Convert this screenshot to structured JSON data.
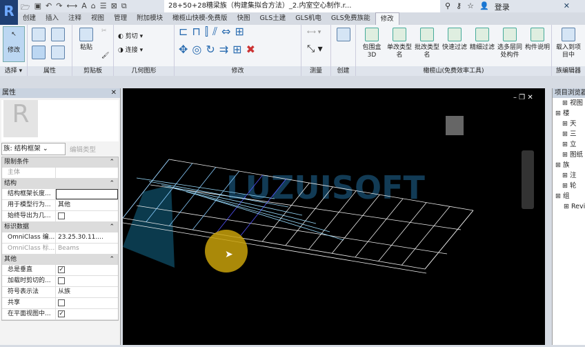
{
  "app": {
    "logo": "R",
    "doc_title": "28+50+28糟梁族（构建集拟合方法）_2.内室空心制作.r...",
    "login": "登录"
  },
  "tabs": [
    "创建",
    "插入",
    "注释",
    "视图",
    "管理",
    "附加模块",
    "橄榄山快模-免费版",
    "快图",
    "GLS土建",
    "GLS机电",
    "GLS免费族能",
    "修改"
  ],
  "active_tab": "修改",
  "ribbon": {
    "modify": "修改",
    "select": "选择 ▾",
    "properties": "属性",
    "paste": "粘贴",
    "clipboard": "剪贴板",
    "cut": "剪切",
    "join": "连接",
    "geometry": "几何图形",
    "modify_panel": "修改",
    "measure": "测量",
    "create": "创建",
    "tools": [
      "包围盒3D",
      "单改类型名",
      "批改类型名",
      "快速过滤",
      "精细过滤",
      "选多层同处构件",
      "构件说明"
    ],
    "tools_panel": "橄榄山(免费效率工具)",
    "load": "载入到项目中",
    "family_editor": "族编辑器"
  },
  "properties": {
    "title": "属性",
    "family": "族: 结构框架",
    "edit_type": "编辑类型",
    "sections": [
      {
        "name": "限制条件",
        "rows": [
          {
            "k": "主体",
            "v": "",
            "grey": true
          }
        ]
      },
      {
        "name": "结构",
        "rows": [
          {
            "k": "结构框架长度...",
            "v": "",
            "input": true
          },
          {
            "k": "用于模型行为...",
            "v": "其他"
          },
          {
            "k": "始终导出为几...",
            "check": false
          }
        ]
      },
      {
        "name": "标识数据",
        "rows": [
          {
            "k": "OmniClass 编...",
            "v": "23.25.30.11...."
          },
          {
            "k": "OmniClass 标...",
            "v": "Beams",
            "grey": true
          }
        ]
      },
      {
        "name": "其他",
        "rows": [
          {
            "k": "总是垂直",
            "check": true
          },
          {
            "k": "加载时剪切的...",
            "check": false
          },
          {
            "k": "符号表示法",
            "v": "从族"
          },
          {
            "k": "共享",
            "check": false
          },
          {
            "k": "在平面视图中...",
            "check": true
          }
        ]
      }
    ]
  },
  "browser": {
    "title": "项目浏览器",
    "items": [
      "视图",
      "楼",
      "天",
      "三",
      "立",
      "图纸",
      "族",
      "注",
      "轮",
      "组",
      "Revit"
    ]
  },
  "watermark": "LUZUISOFT"
}
